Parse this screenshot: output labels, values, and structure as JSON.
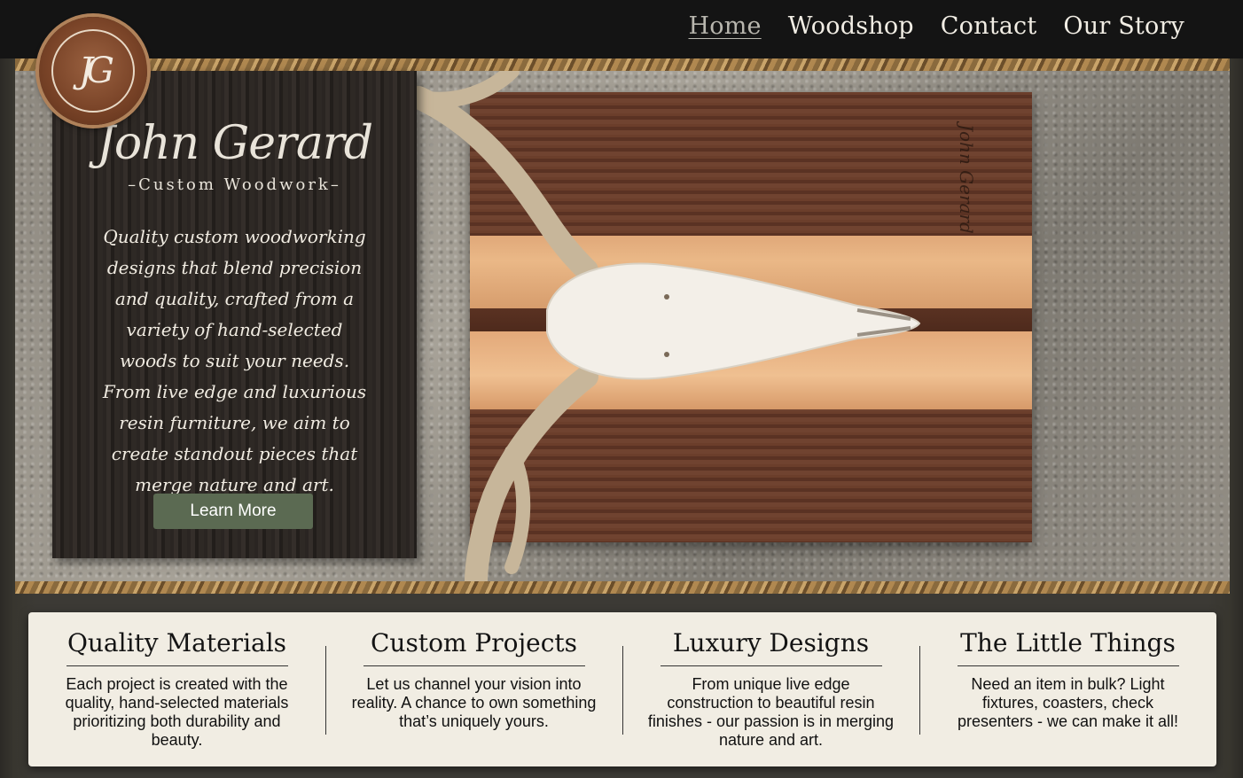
{
  "nav": {
    "items": [
      {
        "label": "Home",
        "active": true
      },
      {
        "label": "Woodshop",
        "active": false
      },
      {
        "label": "Contact",
        "active": false
      },
      {
        "label": "Our Story",
        "active": false
      }
    ]
  },
  "logo": {
    "monogram": "JG"
  },
  "hero": {
    "brand_name": "John Gerard",
    "brand_tagline": "–Custom Woodwork–",
    "description": "Quality custom woodworking designs that blend precision and quality, crafted from a variety of hand-selected woods to suit your needs. From live edge and luxurious resin furniture, we aim to create standout pieces that merge nature and art.",
    "cta_label": "Learn More",
    "board_signature": "John Gerard"
  },
  "features": [
    {
      "title": "Quality Materials",
      "text": "Each project is created with the quality, hand-selected materials prioritizing both durability and beauty."
    },
    {
      "title": "Custom Projects",
      "text": "Let us channel your vision into reality. A chance to own something that’s uniquely yours."
    },
    {
      "title": "Luxury Designs",
      "text": "From unique live edge construction to beautiful resin finishes - our passion is in merging nature and art."
    },
    {
      "title": "The Little Things",
      "text": "Need an item in bulk? Light fixtures, coasters, check presenters - we can make it all!"
    }
  ],
  "colors": {
    "topbar": "#141414",
    "button": "#5b6a52",
    "features_bg": "#f1ede3",
    "frame": "#3c3a35"
  }
}
